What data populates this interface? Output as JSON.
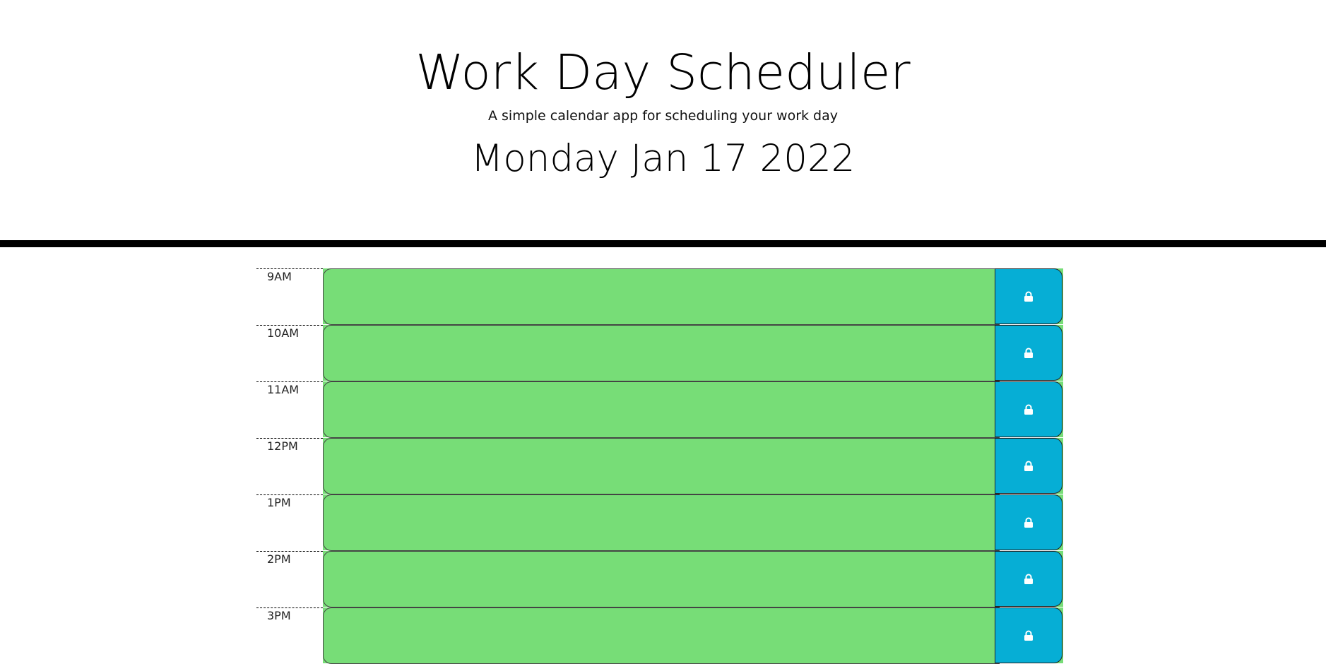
{
  "header": {
    "title": "Work Day Scheduler",
    "subtitle": "A simple calendar app for scheduling your work day",
    "current_day": "Monday Jan 17 2022"
  },
  "colors": {
    "future": "#77dd77",
    "save_button": "#06aed5",
    "icon": "#ffffff"
  },
  "save_icon": "lock-icon",
  "time_blocks": [
    {
      "hour": "9AM",
      "description": ""
    },
    {
      "hour": "10AM",
      "description": ""
    },
    {
      "hour": "11AM",
      "description": ""
    },
    {
      "hour": "12PM",
      "description": ""
    },
    {
      "hour": "1PM",
      "description": ""
    },
    {
      "hour": "2PM",
      "description": ""
    },
    {
      "hour": "3PM",
      "description": ""
    }
  ]
}
